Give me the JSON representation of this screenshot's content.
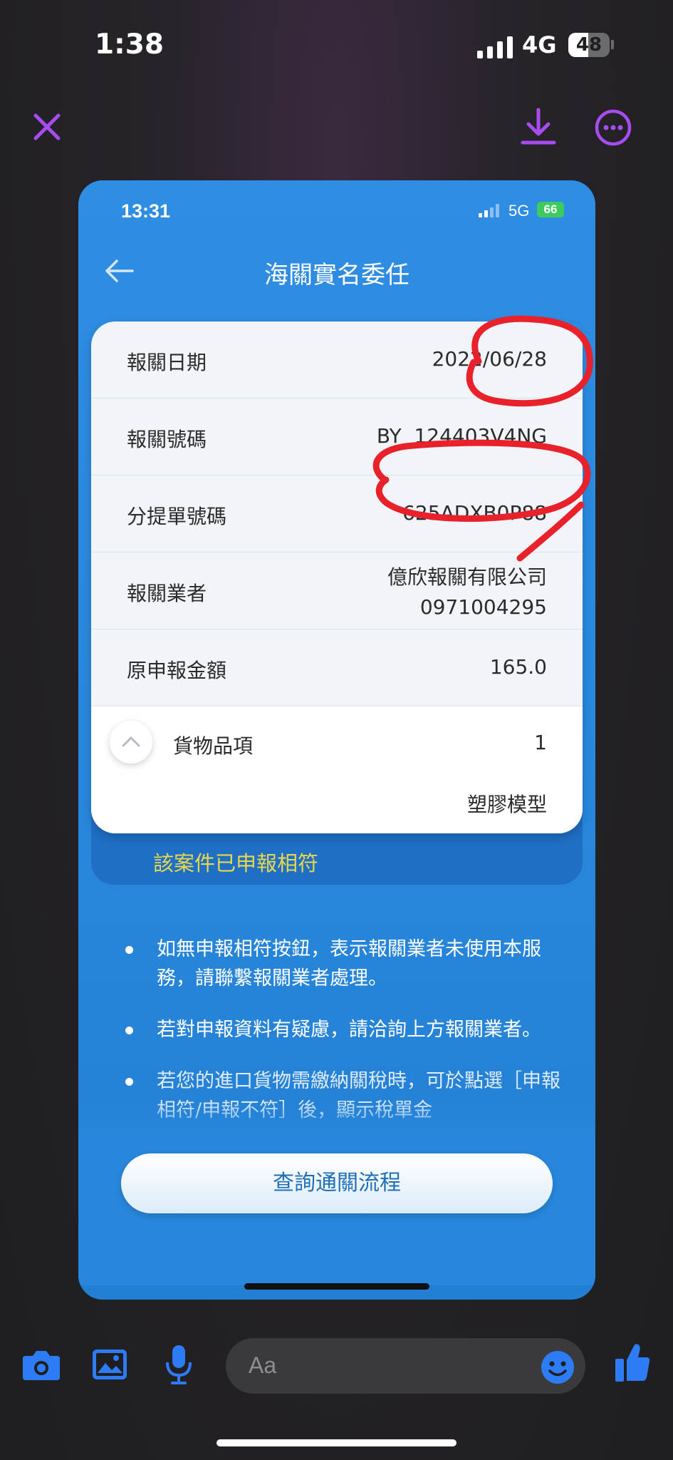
{
  "outer_status": {
    "time": "1:38",
    "network": "4G",
    "battery": "48",
    "battery_level": 0.48
  },
  "viewer": {
    "close_icon": "close-icon",
    "download_icon": "download-icon",
    "more_icon": "more-icon"
  },
  "inner_status": {
    "time": "13:31",
    "network": "5G",
    "battery": "66"
  },
  "page": {
    "title": "海關實名委任",
    "back_icon": "arrow-left-icon"
  },
  "details": [
    {
      "label": "報關日期",
      "value": "2022/06/28"
    },
    {
      "label": "報關號碼",
      "value": "BY  124403V4NG"
    },
    {
      "label": "分提單號碼",
      "value": "625ADXB0P88"
    },
    {
      "label": "報關業者",
      "value": "億欣報關有限公司",
      "value2": "0971004295"
    },
    {
      "label": "原申報金額",
      "value": "165.0"
    }
  ],
  "goods": {
    "label": "貨物品項",
    "count": "1",
    "item": "塑膠模型",
    "toggle_icon": "chevron-up-icon"
  },
  "status": {
    "text": "該案件已申報相符",
    "color": "#e8d84b"
  },
  "notes": [
    "如無申報相符按鈕，表示報關業者未使用本服務，請聯繫報關業者處理。",
    "若對申報資料有疑慮，請洽詢上方報關業者。",
    "若您的進口貨物需繳納關稅時，可於點選［申報相符/申報不符］後，顯示稅單金"
  ],
  "actions": {
    "query_button": "查詢通關流程"
  },
  "composer": {
    "placeholder": "Aa",
    "camera_icon": "camera-icon",
    "gallery_icon": "image-icon",
    "mic_icon": "microphone-icon",
    "emoji_icon": "emoji-icon",
    "like_icon": "thumbs-up-icon"
  },
  "colors": {
    "accent_purple": "#a64cf0",
    "messenger_blue": "#2d7cf6",
    "annotation_red": "#e8212a",
    "card_blue": "#2887dc"
  }
}
